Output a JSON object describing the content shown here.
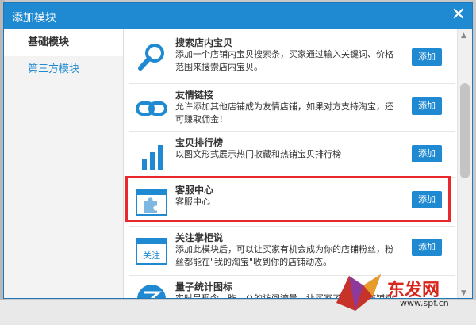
{
  "dialog": {
    "title": "添加模块",
    "close_glyph": "✕"
  },
  "sidebar": {
    "items": [
      {
        "label": "基础模块",
        "active": true
      },
      {
        "label": "第三方模块",
        "active": false
      }
    ]
  },
  "modules": [
    {
      "title": "搜索店内宝贝",
      "desc": "添加一个店铺内宝贝搜索条，买家通过输入关键词、价格范围来搜索店内宝贝。",
      "icon": "search-icon",
      "button": "添加"
    },
    {
      "title": "友情链接",
      "desc": "允许添加其他店铺成为友情店铺，如果对方支持淘宝，还可赚取佣金！",
      "icon": "link-icon",
      "button": "添加"
    },
    {
      "title": "宝贝排行榜",
      "desc": "以图文形式展示热门收藏和热销宝贝排行榜",
      "icon": "bar-chart-icon",
      "button": "添加"
    },
    {
      "title": "客服中心",
      "desc": "客服中心",
      "icon": "puzzle-window-icon",
      "button": "添加"
    },
    {
      "title": "关注掌柜说",
      "desc": "添加此模块后，可以让买家有机会成为你的店铺粉丝，粉丝都能在\"我的淘宝\"收到你的店铺动态。",
      "icon": "follow-window-icon",
      "follow_label": "关注",
      "button": "添加"
    },
    {
      "title": "量子统计图标",
      "desc": "实时呈现今、昨、总的访问流量，让买家了解你的店铺动态！用数据说话，让买家增加信任和青睐。",
      "icon": "stats-logo-icon",
      "button": ""
    }
  ],
  "watermark": {
    "brand": "东发网",
    "url": "www.spf.cn"
  },
  "colors": {
    "accent": "#1f8ad2",
    "highlight": "#e8282a"
  }
}
